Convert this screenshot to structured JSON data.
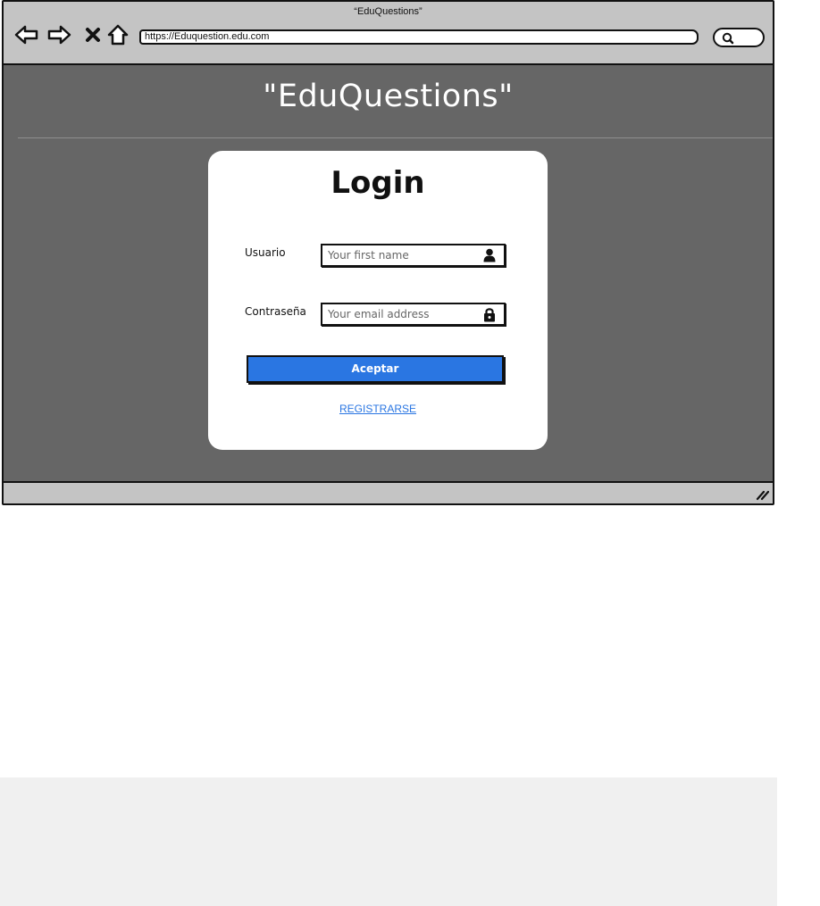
{
  "window": {
    "title": "“EduQuestions”"
  },
  "browser": {
    "url": "https://Eduquestion.edu.com",
    "nav_icons": [
      "back-arrow-icon",
      "forward-arrow-icon",
      "close-icon",
      "home-icon"
    ],
    "search_icon": "search-icon"
  },
  "page": {
    "site_title": "\"EduQuestions\""
  },
  "login": {
    "title": "Login",
    "username_label": "Usuario",
    "username_placeholder": "Your first name",
    "username_icon": "user-icon",
    "password_label": "Contraseña",
    "password_placeholder": "Your email address",
    "password_icon": "lock-icon",
    "accept_label": "Aceptar",
    "register_label": "REGISTRARSE"
  },
  "colors": {
    "page_background": "#666666",
    "chrome": "#c4c4c4",
    "button": "#2a76e2",
    "link": "#2a76e2",
    "card": "#ffffff",
    "bottom_panel": "#f0f0f0"
  }
}
